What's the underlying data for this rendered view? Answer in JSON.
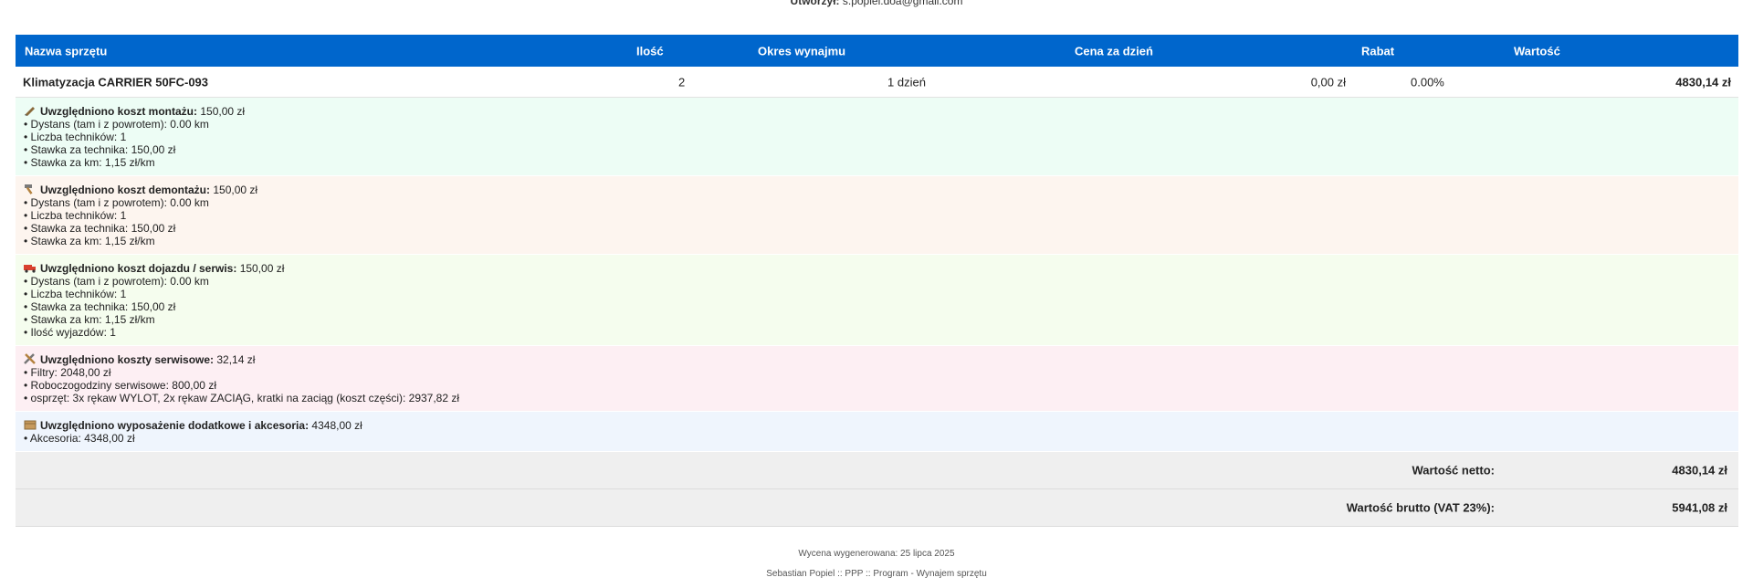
{
  "header": {
    "created_label": "Utworzył:",
    "created_value": "s.popiel.doa@gmail.com"
  },
  "table": {
    "columns": [
      "Nazwa sprzętu",
      "Ilość",
      "Okres wynajmu",
      "Cena za dzień",
      "Rabat",
      "Wartość"
    ],
    "row": {
      "name": "Klimatyzacja CARRIER 50FC-093",
      "qty": "2",
      "period": "1 dzień",
      "price": "0,00 zł",
      "discount": "0.00%",
      "value": "4830,14 zł"
    }
  },
  "sections": [
    {
      "icon": "pencil-icon",
      "color": "#edfdf5",
      "title": "Uwzględniono koszt montażu:",
      "amount": "150,00 zł",
      "items": [
        "• Dystans (tam i z powrotem): 0.00 km",
        "• Liczba techników: 1",
        "• Stawka za technika: 150,00 zł",
        "• Stawka za km: 1,15 zł/km"
      ]
    },
    {
      "icon": "hammer-icon",
      "color": "#fdf5ef",
      "title": "Uwzględniono koszt demontażu:",
      "amount": "150,00 zł",
      "items": [
        "• Dystans (tam i z powrotem): 0.00 km",
        "• Liczba techników: 1",
        "• Stawka za technika: 150,00 zł",
        "• Stawka za km: 1,15 zł/km"
      ]
    },
    {
      "icon": "truck-icon",
      "color": "#f5fdee",
      "title": "Uwzględniono koszt dojazdu / serwis:",
      "amount": "150,00 zł",
      "items": [
        "• Dystans (tam i z powrotem): 0.00 km",
        "• Liczba techników: 1",
        "• Stawka za technika: 150,00 zł",
        "• Stawka za km: 1,15 zł/km",
        "• Ilość wyjazdów: 1"
      ]
    },
    {
      "icon": "tools-icon",
      "color": "#fdeff3",
      "title": "Uwzględniono koszty serwisowe:",
      "amount": "32,14 zł",
      "items": [
        "• Filtry: 2048,00 zł",
        "• Roboczogodziny serwisowe: 800,00 zł",
        "• osprzęt: 3x rękaw WYLOT, 2x rękaw ZACIĄG, kratki na zaciąg (koszt części): 2937,82 zł"
      ]
    },
    {
      "icon": "box-icon",
      "color": "#eff5fd",
      "title": "Uwzględniono wyposażenie dodatkowe i akcesoria:",
      "amount": "4348,00 zł",
      "items": [
        "• Akcesoria: 4348,00 zł"
      ]
    }
  ],
  "totals": {
    "net_label": "Wartość netto:",
    "net_value": "4830,14 zł",
    "gross_label": "Wartość brutto (VAT 23%):",
    "gross_value": "5941,08 zł"
  },
  "footer": {
    "generated": "Wycena wygenerowana: 25 lipca 2025",
    "credits": "Sebastian Popiel :: PPP :: Program - Wynajem sprzętu"
  }
}
